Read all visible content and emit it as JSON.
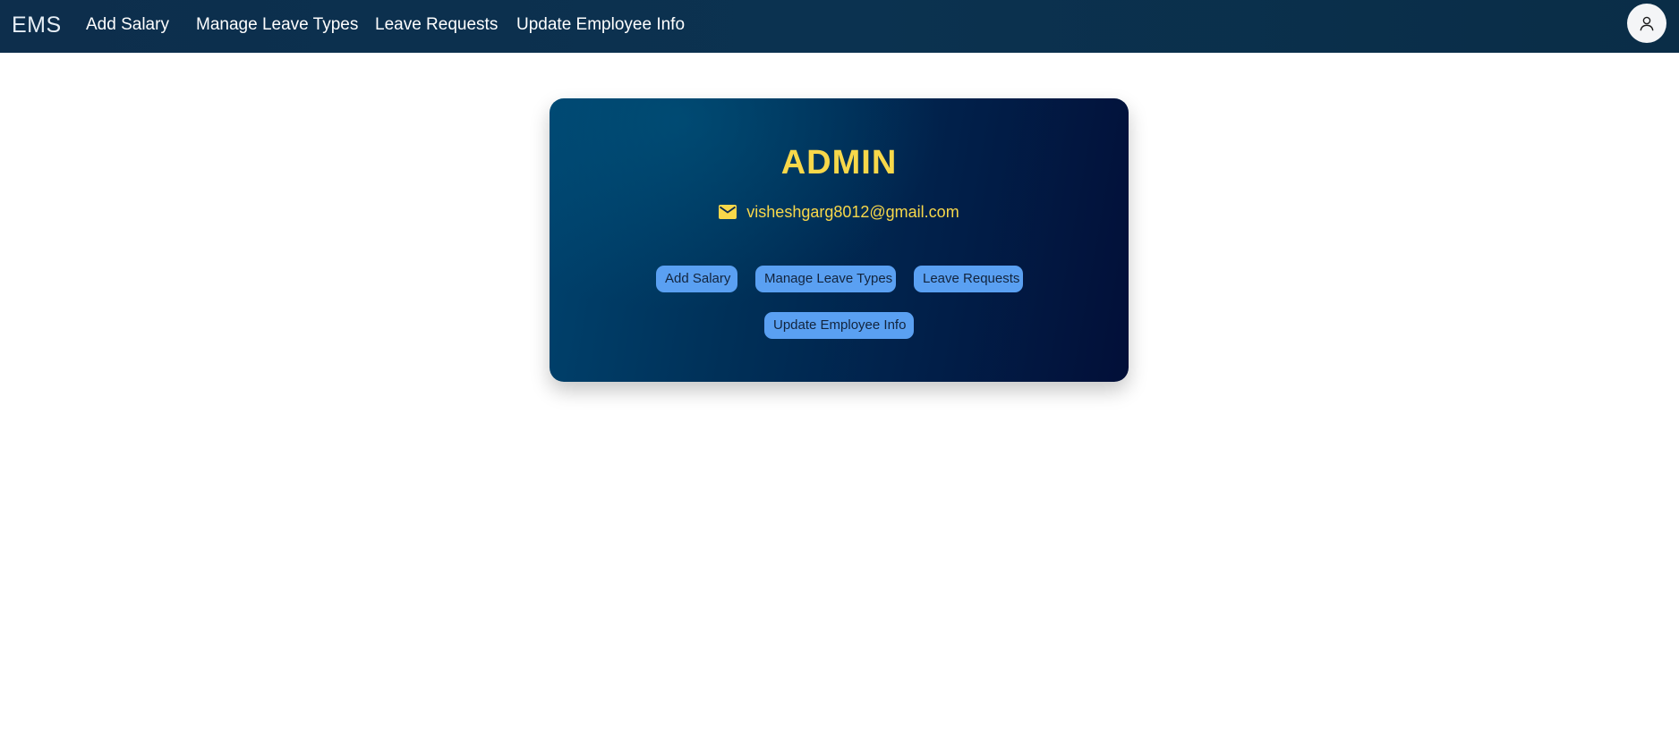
{
  "nav": {
    "brand": "EMS",
    "links": [
      "Add Salary",
      "Manage Leave Types",
      "Leave Requests",
      "Update Employee Info"
    ],
    "avatar_icon": "user-icon"
  },
  "profile": {
    "role": "ADMIN",
    "email_icon": "mail-icon",
    "email": "visheshgarg8012@gmail.com",
    "actions": [
      "Add Salary",
      "Manage Leave Types",
      "Leave Requests",
      "Update Employee Info"
    ]
  },
  "colors": {
    "navbar": "#0b3250",
    "accent_yellow": "#f8d84a",
    "button_blue": "#5aa0f2",
    "card_dark": "#020f38"
  }
}
